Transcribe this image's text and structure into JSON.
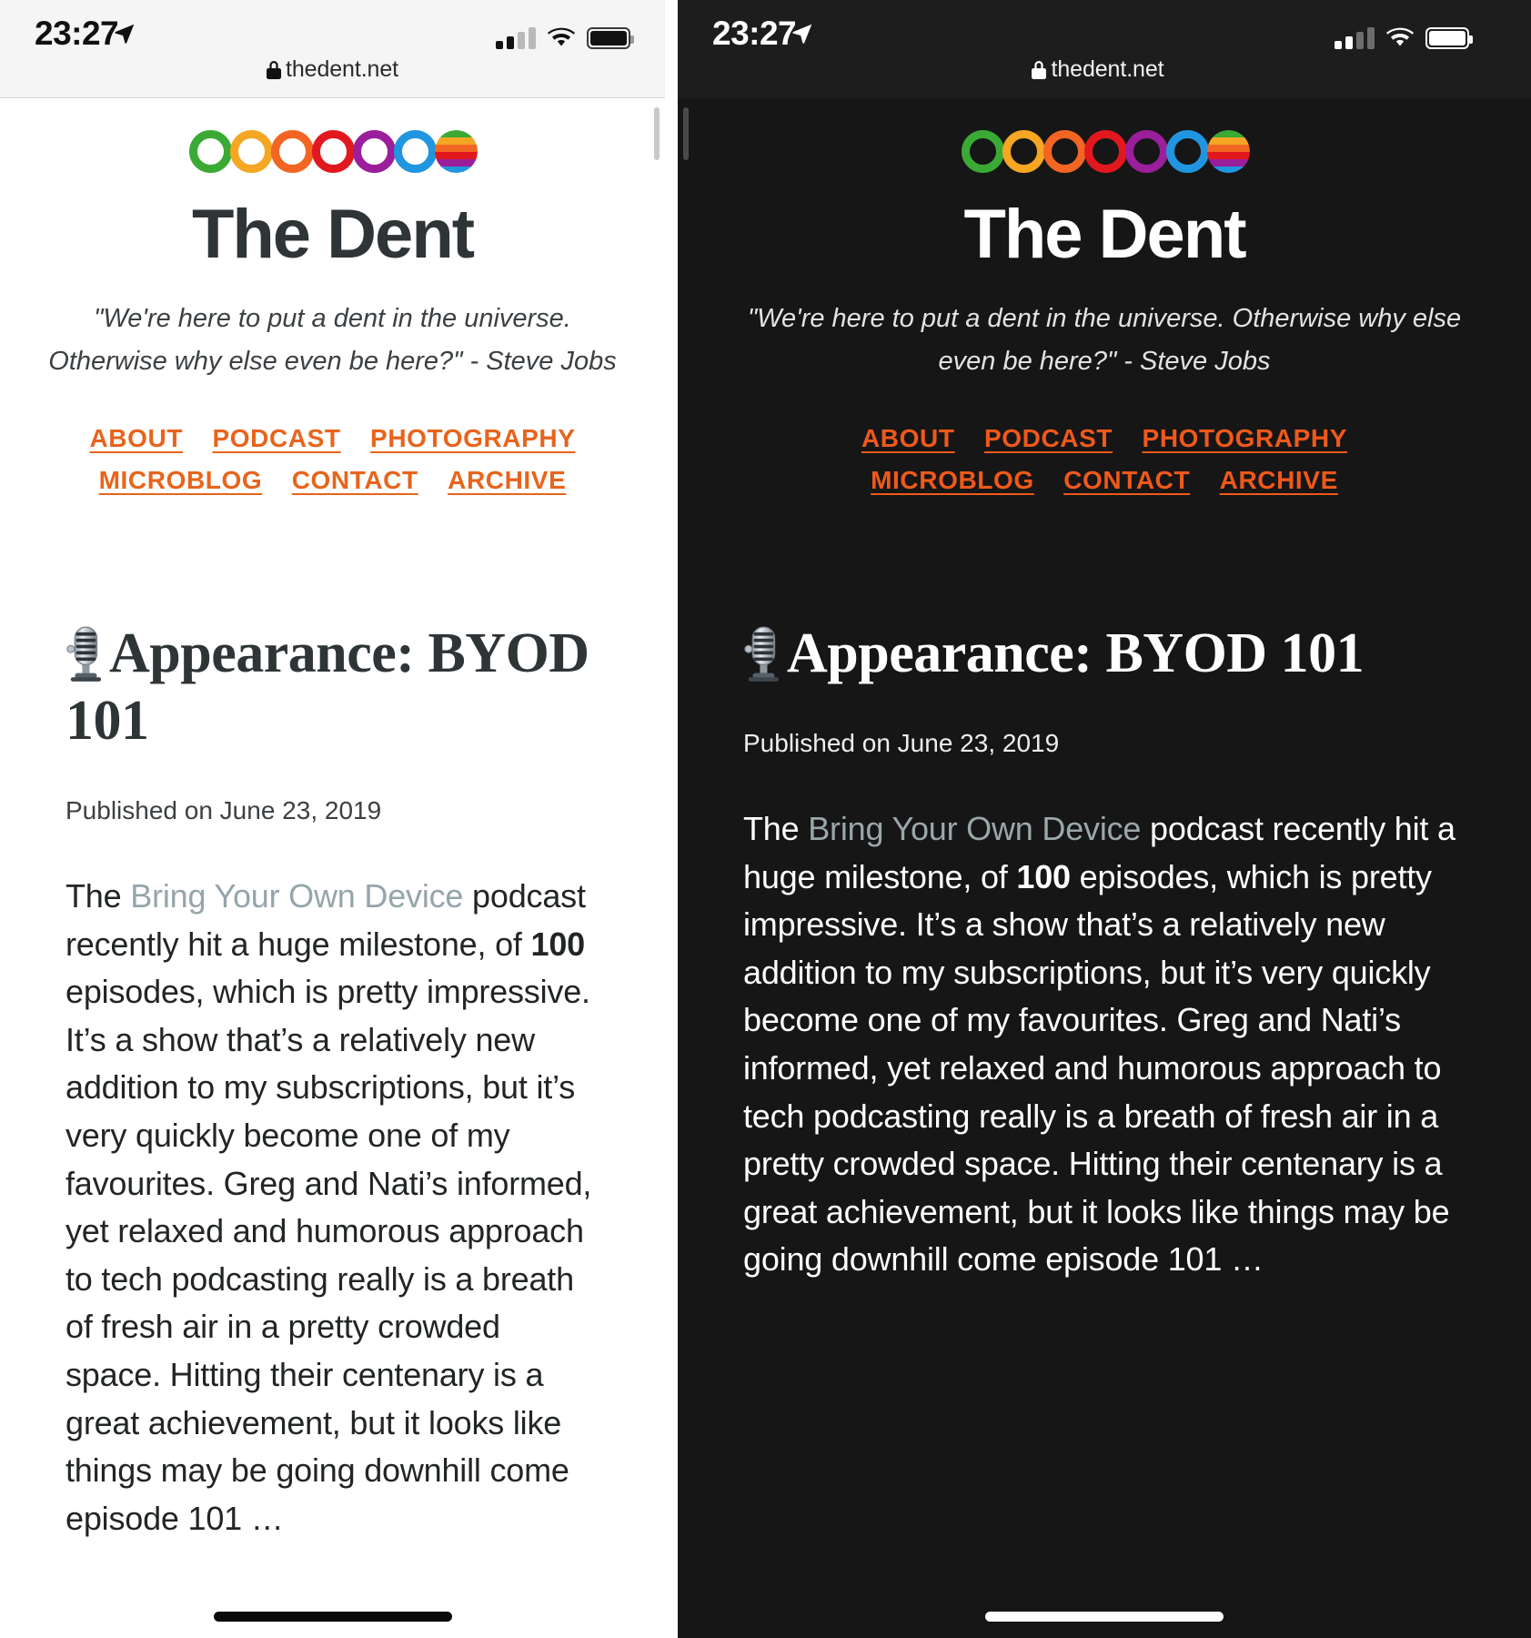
{
  "panels": [
    {
      "theme": "light",
      "status": {
        "time": "23:27",
        "location_icon": "location-arrow-icon",
        "signal_icon": "cellular-signal-icon",
        "wifi_icon": "wifi-icon",
        "battery_icon": "battery-full-icon",
        "url": "thedent.net",
        "lock_icon": "lock-icon"
      },
      "site": {
        "title": "The Dent",
        "quote": "\"We're here to put a dent in the universe. Otherwise why else even be here?\" - Steve Jobs",
        "logo_rings": [
          "#3aaa35",
          "#f5a623",
          "#f26522",
          "#e2181f",
          "#9b1e9b",
          "#2196e0",
          "rainbow"
        ]
      },
      "nav": [
        {
          "label": "ABOUT",
          "name": "nav-link-about"
        },
        {
          "label": "PODCAST",
          "name": "nav-link-podcast"
        },
        {
          "label": "PHOTOGRAPHY",
          "name": "nav-link-photography"
        },
        {
          "label": "MICROBLOG",
          "name": "nav-link-microblog"
        },
        {
          "label": "CONTACT",
          "name": "nav-link-contact"
        },
        {
          "label": "ARCHIVE",
          "name": "nav-link-archive"
        }
      ],
      "post": {
        "emoji": "studio-microphone-icon",
        "title": "Appearance: BYOD 101",
        "date": "Published on June 23, 2019",
        "body_pre_link": "The ",
        "body_link": "Bring Your Own Device",
        "body_mid_1": " podcast recently hit a huge milestone, of ",
        "body_bold": "100",
        "body_rest": " episodes, which is pretty impressive. It’s a show that’s a relatively new addition to my subscriptions, but it’s very quickly become one of my favourites. Greg and Nati’s informed, yet relaxed and humorous approach to tech podcasting really is a breath of fresh air in a pretty crowded space. Hitting their centenary is a great achievement, but it looks like things may be going downhill come episode 101 …"
      }
    },
    {
      "theme": "dark",
      "status": {
        "time": "23:27",
        "location_icon": "location-arrow-icon",
        "signal_icon": "cellular-signal-icon",
        "wifi_icon": "wifi-icon",
        "battery_icon": "battery-full-icon",
        "url": "thedent.net",
        "lock_icon": "lock-icon"
      },
      "site": {
        "title": "The Dent",
        "quote": "\"We're here to put a dent in the universe. Otherwise why else even be here?\" - Steve Jobs",
        "logo_rings": [
          "#3aaa35",
          "#f5a623",
          "#f26522",
          "#e2181f",
          "#9b1e9b",
          "#2196e0",
          "rainbow"
        ]
      },
      "nav": [
        {
          "label": "ABOUT",
          "name": "nav-link-about"
        },
        {
          "label": "PODCAST",
          "name": "nav-link-podcast"
        },
        {
          "label": "PHOTOGRAPHY",
          "name": "nav-link-photography"
        },
        {
          "label": "MICROBLOG",
          "name": "nav-link-microblog"
        },
        {
          "label": "CONTACT",
          "name": "nav-link-contact"
        },
        {
          "label": "ARCHIVE",
          "name": "nav-link-archive"
        }
      ],
      "post": {
        "emoji": "studio-microphone-icon",
        "title": "Appearance: BYOD 101",
        "date": "Published on June 23, 2019",
        "body_pre_link": "The ",
        "body_link": "Bring Your Own Device",
        "body_mid_1": " podcast recently hit a huge milestone, of ",
        "body_bold": "100",
        "body_rest": " episodes, which is pretty impressive. It’s a show that’s a relatively new addition to my subscriptions, but it’s very quickly become one of my favourites. Greg and Nati’s informed, yet relaxed and humorous approach to tech podcasting really is a breath of fresh air in a pretty crowded space. Hitting their centenary is a great achievement, but it looks like things may be going downhill come episode 101 …"
      }
    }
  ],
  "colors": {
    "accent_orange": "#e8641c",
    "link_gray_blue": "#95a5a9",
    "light_bg": "#ffffff",
    "dark_bg": "#161616",
    "light_statusbar": "#f5f5f5",
    "dark_statusbar": "#1d1d1d"
  }
}
